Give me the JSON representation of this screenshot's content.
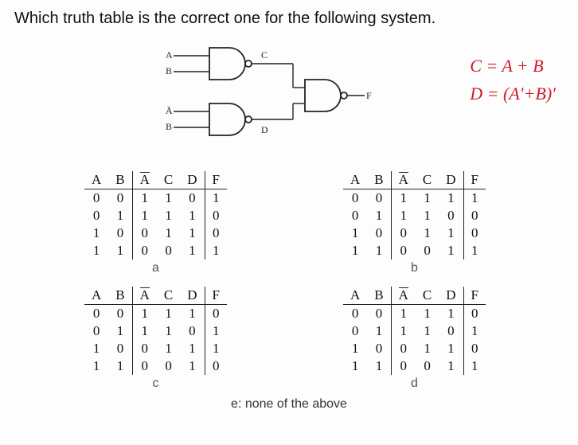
{
  "question": "Which truth table is the correct one for the following system.",
  "circuit": {
    "in1": "A",
    "in2": "B",
    "in3": "Ā",
    "in4": "B",
    "mid1": "C",
    "mid2": "D",
    "out": "F"
  },
  "annotations": {
    "line1": "C = A + B",
    "line2": "D = (A′+B)′"
  },
  "headers": [
    "A",
    "B",
    "Ā",
    "C",
    "D",
    "F"
  ],
  "tables": {
    "a": {
      "label": "a",
      "rows": [
        [
          0,
          0,
          1,
          1,
          0,
          1
        ],
        [
          0,
          1,
          1,
          1,
          1,
          0
        ],
        [
          1,
          0,
          0,
          1,
          1,
          0
        ],
        [
          1,
          1,
          0,
          0,
          1,
          1
        ]
      ]
    },
    "b": {
      "label": "b",
      "rows": [
        [
          0,
          0,
          1,
          1,
          1,
          1
        ],
        [
          0,
          1,
          1,
          1,
          0,
          0
        ],
        [
          1,
          0,
          0,
          1,
          1,
          0
        ],
        [
          1,
          1,
          0,
          0,
          1,
          1
        ]
      ]
    },
    "c": {
      "label": "c",
      "rows": [
        [
          0,
          0,
          1,
          1,
          1,
          0
        ],
        [
          0,
          1,
          1,
          1,
          0,
          1
        ],
        [
          1,
          0,
          0,
          1,
          1,
          1
        ],
        [
          1,
          1,
          0,
          0,
          1,
          0
        ]
      ]
    },
    "d": {
      "label": "d",
      "rows": [
        [
          0,
          0,
          1,
          1,
          1,
          0
        ],
        [
          0,
          1,
          1,
          1,
          0,
          1
        ],
        [
          1,
          0,
          0,
          1,
          1,
          0
        ],
        [
          1,
          1,
          0,
          0,
          1,
          1
        ]
      ]
    }
  },
  "optE": "e:  none of the above"
}
